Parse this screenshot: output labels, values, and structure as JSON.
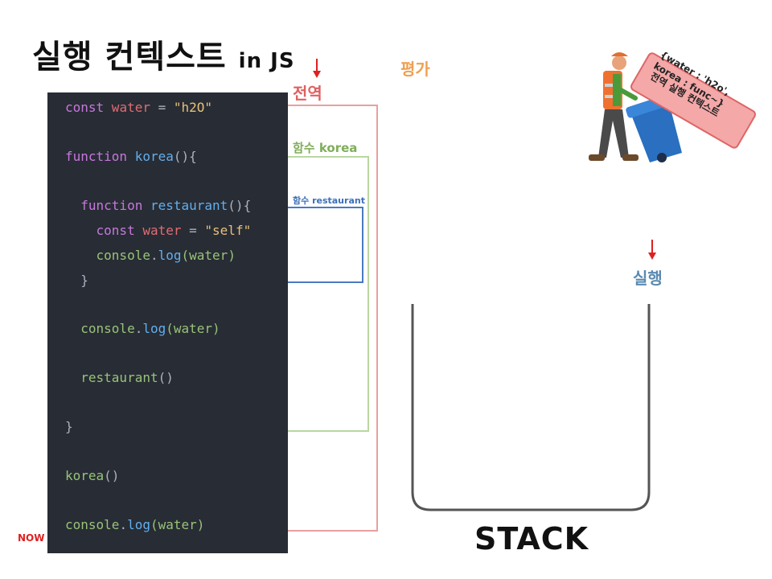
{
  "title": {
    "main": "실행 컨텍스트",
    "suffix": "in JS"
  },
  "code": {
    "lines": [
      {
        "parts": [
          {
            "t": "const",
            "c": "kw"
          },
          {
            "t": " water",
            "c": "var"
          },
          {
            "t": " = ",
            "c": "plain"
          },
          {
            "t": "\"h2O\"",
            "c": "str"
          }
        ]
      },
      {
        "parts": [
          {
            "t": "function",
            "c": "kw"
          },
          {
            "t": " korea",
            "c": "fn"
          },
          {
            "t": "(){",
            "c": "plain"
          }
        ]
      },
      {
        "parts": [
          {
            "t": "  function",
            "c": "kw"
          },
          {
            "t": " restaurant",
            "c": "fn"
          },
          {
            "t": "(){",
            "c": "plain"
          }
        ]
      },
      {
        "parts": [
          {
            "t": "    const",
            "c": "kw"
          },
          {
            "t": " water",
            "c": "var"
          },
          {
            "t": " = ",
            "c": "plain"
          },
          {
            "t": "\"self\"",
            "c": "str"
          }
        ]
      },
      {
        "parts": [
          {
            "t": "    console",
            "c": "green"
          },
          {
            "t": ".",
            "c": "plain"
          },
          {
            "t": "log",
            "c": "fn"
          },
          {
            "t": "(water)",
            "c": "green"
          }
        ]
      },
      {
        "parts": [
          {
            "t": "  }",
            "c": "plain"
          }
        ]
      },
      {
        "parts": [
          {
            "t": "  console",
            "c": "green"
          },
          {
            "t": ".",
            "c": "plain"
          },
          {
            "t": "log",
            "c": "fn"
          },
          {
            "t": "(water)",
            "c": "green"
          }
        ]
      },
      {
        "parts": [
          {
            "t": "  restaurant",
            "c": "green"
          },
          {
            "t": "()",
            "c": "plain"
          }
        ]
      },
      {
        "parts": [
          {
            "t": "}",
            "c": "plain"
          }
        ]
      },
      {
        "parts": [
          {
            "t": "korea",
            "c": "green"
          },
          {
            "t": "()",
            "c": "plain"
          }
        ]
      },
      {
        "parts": [
          {
            "t": "console",
            "c": "green"
          },
          {
            "t": ".",
            "c": "plain"
          },
          {
            "t": "log",
            "c": "fn"
          },
          {
            "t": "(water)",
            "c": "green"
          }
        ]
      }
    ]
  },
  "scopes": {
    "global": "전역",
    "korea": "함수 korea",
    "restaurant": "함수 restaurant"
  },
  "labels": {
    "evaluation": "평가",
    "execution": "실행",
    "now": "NOW",
    "stack": "STACK"
  },
  "context_card": {
    "label": "전역 실행 컨텍스트",
    "values": [
      "{water : 'h2o',",
      "korea : func~}"
    ]
  },
  "colors": {
    "global": "#e8a0a0",
    "korea": "#b9d7a0",
    "restaurant": "#4a7ac0",
    "arrow": "#e02020"
  }
}
